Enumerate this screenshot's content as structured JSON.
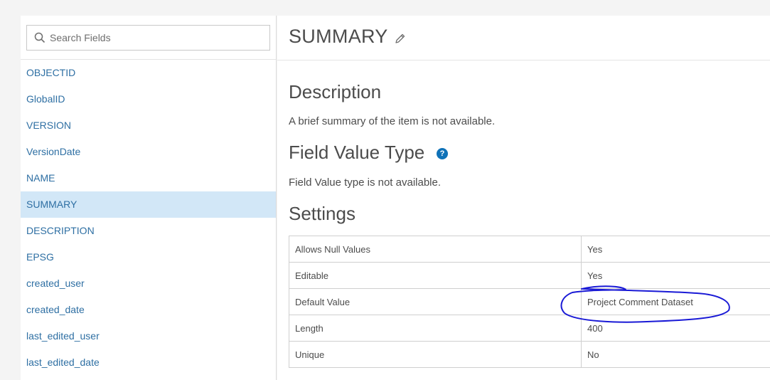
{
  "search": {
    "placeholder": "Search Fields",
    "icon": "search-icon"
  },
  "fields": [
    {
      "label": "OBJECTID",
      "selected": false
    },
    {
      "label": "GlobalID",
      "selected": false
    },
    {
      "label": "VERSION",
      "selected": false
    },
    {
      "label": "VersionDate",
      "selected": false
    },
    {
      "label": "NAME",
      "selected": false
    },
    {
      "label": "SUMMARY",
      "selected": true
    },
    {
      "label": "DESCRIPTION",
      "selected": false
    },
    {
      "label": "EPSG",
      "selected": false
    },
    {
      "label": "created_user",
      "selected": false
    },
    {
      "label": "created_date",
      "selected": false
    },
    {
      "label": "last_edited_user",
      "selected": false
    },
    {
      "label": "last_edited_date",
      "selected": false
    }
  ],
  "main": {
    "title": "SUMMARY",
    "description": {
      "heading": "Description",
      "text": "A brief summary of the item is not available."
    },
    "field_value_type": {
      "heading": "Field Value Type",
      "help": "?",
      "text": "Field Value type is not available."
    },
    "settings": {
      "heading": "Settings",
      "rows": [
        {
          "label": "Allows Null Values",
          "value": "Yes"
        },
        {
          "label": "Editable",
          "value": "Yes"
        },
        {
          "label": "Default Value",
          "value": "Project Comment Dataset"
        },
        {
          "label": "Length",
          "value": "400"
        },
        {
          "label": "Unique",
          "value": "No"
        }
      ]
    }
  },
  "colors": {
    "link": "#2e6fa3",
    "selected_bg": "#d2e7f7",
    "annotation": "#1a1ad6",
    "help_icon": "#0f72b8"
  }
}
